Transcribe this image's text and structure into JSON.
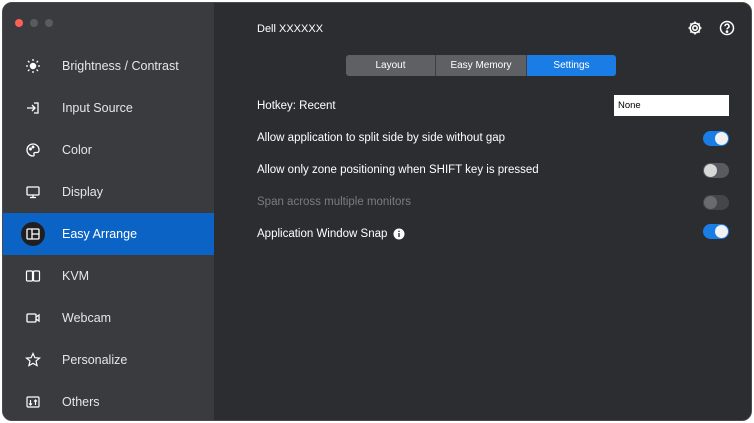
{
  "window": {
    "title": "Dell XXXXXX"
  },
  "sidebar": {
    "items": [
      {
        "label": "Brightness / Contrast",
        "icon": "sun-icon"
      },
      {
        "label": "Input Source",
        "icon": "input-source-icon"
      },
      {
        "label": "Color",
        "icon": "color-palette-icon"
      },
      {
        "label": "Display",
        "icon": "monitor-icon"
      },
      {
        "label": "Easy Arrange",
        "icon": "easy-arrange-icon",
        "active": true
      },
      {
        "label": "KVM",
        "icon": "kvm-icon"
      },
      {
        "label": "Webcam",
        "icon": "webcam-icon"
      },
      {
        "label": "Personalize",
        "icon": "star-icon"
      },
      {
        "label": "Others",
        "icon": "others-icon"
      }
    ]
  },
  "header": {
    "icons": [
      "gear-icon",
      "help-icon"
    ]
  },
  "tabs": [
    {
      "label": "Layout"
    },
    {
      "label": "Easy Memory"
    },
    {
      "label": "Settings",
      "selected": true
    }
  ],
  "settings": {
    "hotkey_label": "Hotkey: Recent",
    "hotkey_value": "None",
    "split_label": "Allow application to split side by side without gap",
    "split_on": true,
    "shift_label": "Allow only zone positioning when SHIFT key is pressed",
    "shift_on": false,
    "span_label": "Span across multiple monitors",
    "span_enabled": false,
    "snap_label": "Application Window Snap",
    "snap_on": true
  },
  "colors": {
    "accent": "#1a7de6",
    "active_nav": "#0b63c5",
    "sidebar_bg": "#3a3b3f",
    "main_bg": "#2c2d31"
  }
}
